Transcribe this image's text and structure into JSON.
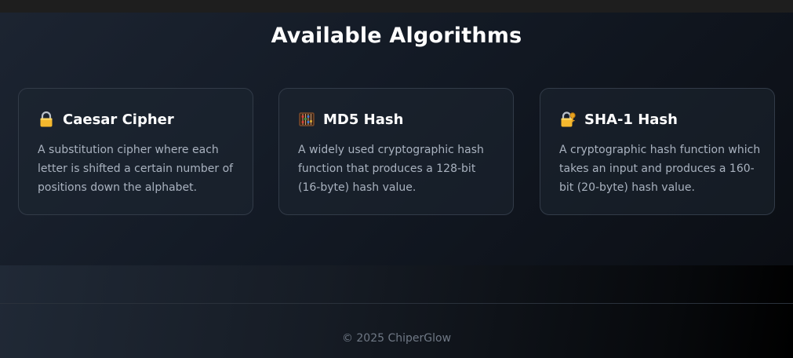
{
  "section": {
    "title": "Available Algorithms"
  },
  "algorithms": [
    {
      "icon": "lock-icon",
      "title": "Caesar Cipher",
      "description": "A substitution cipher where each letter is shifted a certain number of positions down the alphabet."
    },
    {
      "icon": "abacus-icon",
      "title": "MD5 Hash",
      "description": "A widely used cryptographic hash function that produces a 128-bit (16-byte) hash value."
    },
    {
      "icon": "lock-with-key-icon",
      "title": "SHA-1 Hash",
      "description": "A cryptographic hash function which takes an input and produces a 160-bit (20-byte) hash value."
    }
  ],
  "footer": {
    "copyright": "© 2025 ChiperGlow"
  },
  "colors": {
    "card_border": "#323b48",
    "text_muted": "#a9b2bf",
    "lock_gold": "#f5b82e"
  }
}
